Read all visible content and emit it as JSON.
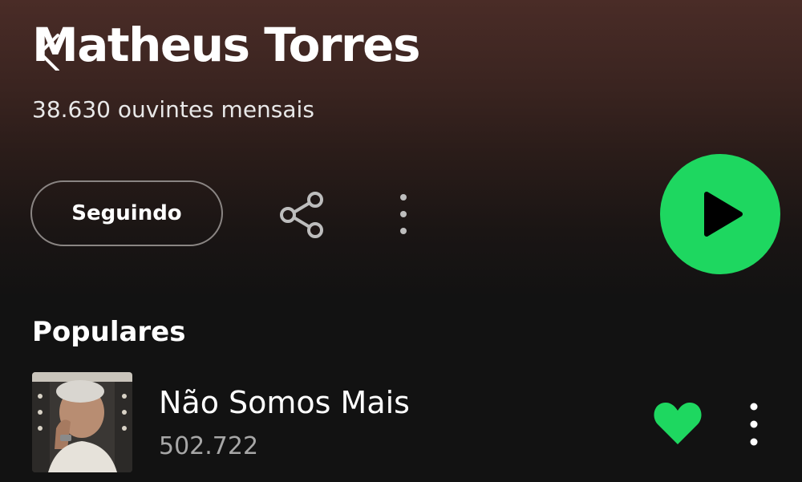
{
  "artist": {
    "name": "Matheus Torres",
    "monthly_listeners": "38.630 ouvintes mensais"
  },
  "actions": {
    "follow_label": "Seguindo",
    "share_icon": "share-icon",
    "more_icon": "more-vertical-icon",
    "play_icon": "play-icon",
    "play_color": "#1ed760"
  },
  "popular": {
    "title": "Populares",
    "tracks": [
      {
        "title": "Não Somos Mais",
        "plays": "502.722",
        "liked": true,
        "heart_color": "#1ed760"
      }
    ]
  }
}
